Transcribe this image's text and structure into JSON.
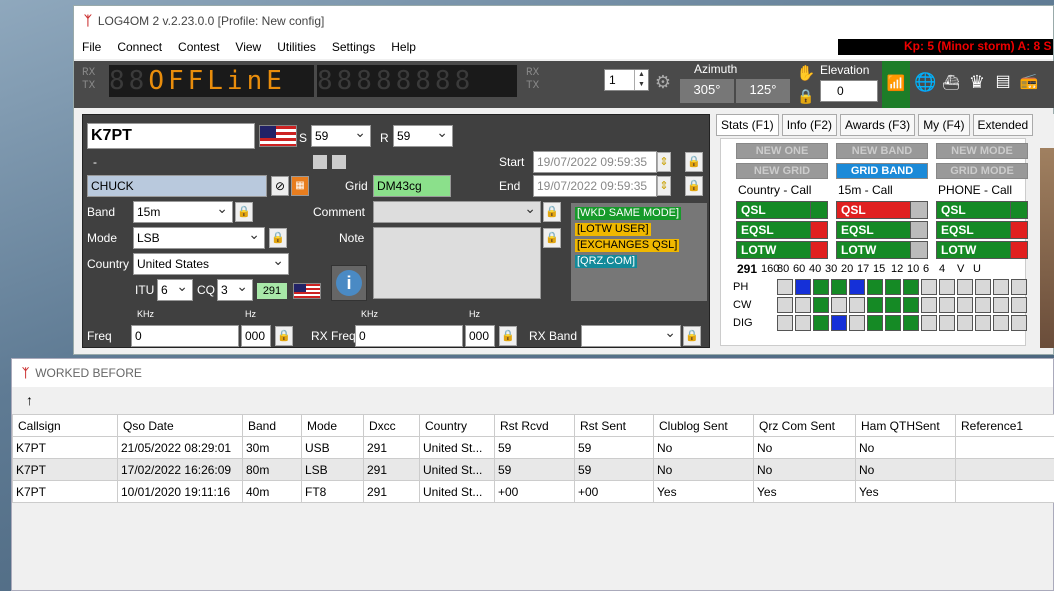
{
  "main_window": {
    "title": "LOG4OM 2 v.2.23.0.0 [Profile: New config]",
    "menu": [
      "File",
      "Connect",
      "Contest",
      "View",
      "Utilities",
      "Settings",
      "Help"
    ],
    "kp_status": "Kp: 5 (Minor storm)  A: 8  S"
  },
  "toolbar": {
    "rx": "RX",
    "tx": "TX",
    "display_text": "OFFLinE",
    "display_dim": "88",
    "display2": "88888888",
    "rotor_value": "1",
    "azimuth_label": "Azimuth",
    "azimuth_current": "305°",
    "azimuth_target": "125°",
    "elevation_label": "Elevation",
    "elevation_value": "0"
  },
  "qso": {
    "callsign": "K7PT",
    "rst_s_label": "S",
    "rst_s": "59",
    "rst_r_label": "R",
    "rst_r": "59",
    "dash": "-",
    "name": "CHUCK",
    "grid_label": "Grid",
    "grid": "DM43cg",
    "start_label": "Start",
    "start": "19/07/2022 09:59:35",
    "end_label": "End",
    "end": "19/07/2022 09:59:35",
    "band_label": "Band",
    "band": "15m",
    "mode_label": "Mode",
    "mode": "LSB",
    "country_label": "Country",
    "country": "United States",
    "itu_label": "ITU",
    "itu": "6",
    "cq_label": "CQ",
    "cq": "3",
    "dxcc": "291",
    "comment_label": "Comment",
    "note_label": "Note",
    "freq_label": "Freq",
    "khz_label": "KHz",
    "hz_label": "Hz",
    "freq_khz": "0",
    "freq_hz": "000",
    "rxfreq_label": "RX Freq",
    "rxfreq_khz": "0",
    "rxfreq_hz": "000",
    "rxband_label": "RX Band",
    "tags": [
      "[WKD SAME MODE]",
      "[LOTW USER]",
      "[EXCHANGES QSL]",
      "[QRZ.COM]"
    ]
  },
  "stats": {
    "tabs": [
      "Stats (F1)",
      "Info (F2)",
      "Awards (F3)",
      "My (F4)",
      "Extended"
    ],
    "buttons": [
      "NEW ONE",
      "NEW BAND",
      "NEW MODE",
      "NEW GRID",
      "GRID BAND",
      "GRID MODE"
    ],
    "col_titles": [
      "Country - Call",
      "15m - Call",
      "PHONE - Call"
    ],
    "rows": [
      "QSL",
      "EQSL",
      "LOTW"
    ],
    "dxcc": "291",
    "bands": [
      "160",
      "80",
      "60",
      "40",
      "30",
      "20",
      "17",
      "15",
      "12",
      "10",
      "6",
      "4",
      "V",
      "U"
    ],
    "modes": [
      "PH",
      "CW",
      "DIG"
    ]
  },
  "worked_before": {
    "title": "WORKED BEFORE",
    "up_arrow": "↑",
    "columns": [
      "Callsign",
      "Qso Date",
      "Band",
      "Mode",
      "Dxcc",
      "Country",
      "Rst Rcvd",
      "Rst Sent",
      "Clublog Sent",
      "Qrz Com Sent",
      "Ham QTHSent",
      "Reference1"
    ],
    "rows": [
      [
        "K7PT",
        "21/05/2022 08:29:01",
        "30m",
        "USB",
        "291",
        "United St...",
        "59",
        "59",
        "No",
        "No",
        "No",
        ""
      ],
      [
        "K7PT",
        "17/02/2022 16:26:09",
        "80m",
        "LSB",
        "291",
        "United St...",
        "59",
        "59",
        "No",
        "No",
        "No",
        ""
      ],
      [
        "K7PT",
        "10/01/2020 19:11:16",
        "40m",
        "FT8",
        "291",
        "United St...",
        "+00",
        "+00",
        "Yes",
        "Yes",
        "Yes",
        ""
      ]
    ]
  }
}
